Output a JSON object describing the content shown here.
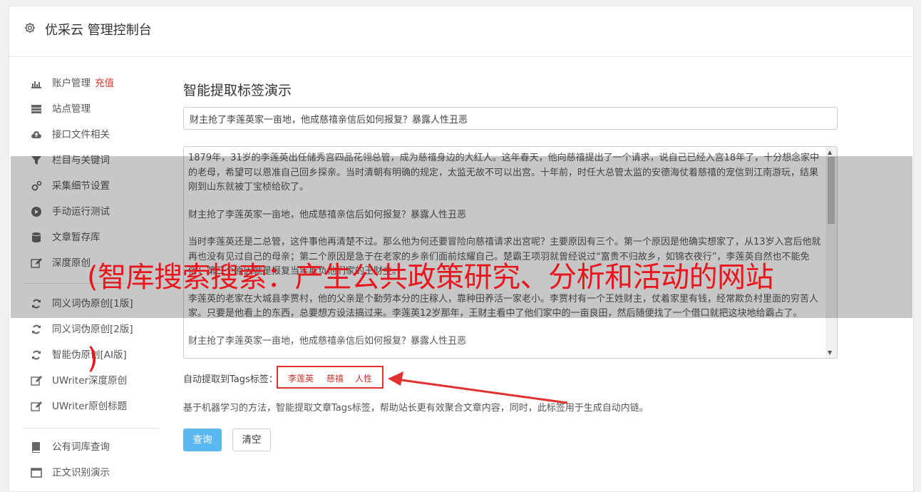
{
  "header": {
    "title": "优采云 管理控制台",
    "icon": "gear-icon"
  },
  "sidebar": {
    "items": [
      {
        "label": "账户管理",
        "extra": "充值",
        "icon": "bar-chart-icon"
      },
      {
        "label": "站点管理",
        "icon": "server-icon"
      },
      {
        "label": "接口文件相关",
        "icon": "cloud-upload-icon"
      },
      {
        "label": "栏目与关键词",
        "icon": "filter-icon"
      },
      {
        "label": "采集细节设置",
        "icon": "gears-icon"
      },
      {
        "label": "手动运行测试",
        "icon": "play-circle-icon"
      },
      {
        "label": "文章暂存库",
        "icon": "database-icon"
      },
      {
        "label": "深度原创",
        "icon": "edit-icon"
      },
      {
        "label": "同义词伪原创[1版]",
        "icon": "refresh-icon"
      },
      {
        "label": "同义词伪原创[2版]",
        "icon": "refresh-icon"
      },
      {
        "label": "智能伪原创[AI版]",
        "icon": "refresh-icon"
      },
      {
        "label": "UWriter深度原创",
        "icon": "edit-icon"
      },
      {
        "label": "UWriter原创标题",
        "icon": "edit-icon"
      },
      {
        "label": "公有词库查询",
        "icon": "book-icon"
      },
      {
        "label": "正文识别演示",
        "icon": "window-icon"
      }
    ]
  },
  "main": {
    "heading": "智能提取标签演示",
    "title_value": "财主抢了李莲英家一亩地，他成慈禧亲信后如何报复？暴露人性丑恶",
    "article_paragraphs": [
      "1879年，31岁的李莲英出任储秀宫四品花翎总管，成为慈禧身边的大红人。这年春天，他向慈禧提出了一个请求，说自己已经入宫18年了，十分想念家中的老母，希望可以恩准自己回乡探亲。当时清朝有明确的规定，太监无故不可以出宫。十年前，时任大总管太监的安德海仗着慈禧的宠信到江南游玩，结果刚到山东就被丁宝桢给砍了。",
      "财主抢了李莲英家一亩地，他成慈禧亲信后如何报复？暴露人性丑恶",
      "当时李莲英还是二总管，这件事他再清楚不过。那么他为何还要冒险向慈禧请求出宫呢？主要原因有三个。第一个原因是他确实想家了，从13岁入宫后他就再也没有见过自己的母亲；第二个原因是急于在老家的乡亲们面前炫耀自己。楚霸王项羽就曾经说过“富贵不归故乡，如锦衣夜行”，李莲英自然也不能免俗；第三个原因就是报复当年欺负他们家的王财主。",
      "李莲英的老家在大城县李贾村，他的父亲是个勤劳本分的庄稼人，靠种田养活一家老小。李贾村有一个王姓财主，仗着家里有钱，经常欺负村里面的穷苦人家。只要是他看上的东西，总要想方设法搞过来。李莲英12岁那年，王财主看中了他们家中的一亩良田，然后随便找了一个借口就把这块地给霸占了。",
      "财主抢了李莲英家一亩地，他成慈禧亲信后如何报复？暴露人性丑恶"
    ],
    "tags_label": "自动提取到Tags标签：",
    "tags": [
      "李莲英",
      "慈禧",
      "人性"
    ],
    "description": "基于机器学习的方法，智能提取文章Tags标签，帮助站长更有效聚合文章内容，同时，此标签用于生成自动内链。",
    "query_button": "查询",
    "clear_button": "清空"
  },
  "watermark": {
    "text": "(智库搜索搜索：产生公共政策研究、分析和活动的网站",
    "text2": ")"
  },
  "colors": {
    "accent": "#5cb8f0",
    "tag": "#c9302c",
    "watermark": "#e8171e",
    "annotation": "#e03030"
  }
}
